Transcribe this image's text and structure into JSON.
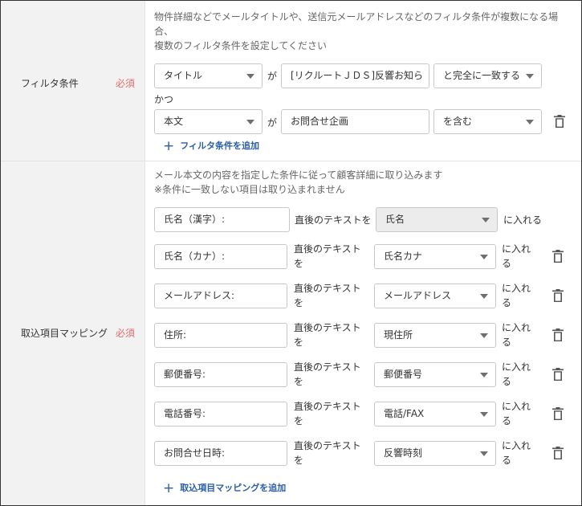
{
  "filter": {
    "label": "フィルタ条件",
    "required": "必須",
    "desc": [
      "物件詳細などでメールタイトルや、送信元メールアドレスなどのフィルタ条件が複数になる場",
      "合、",
      "複数のフィルタ条件を設定してください"
    ],
    "conditions": [
      {
        "field": "タイトル",
        "ga": "が",
        "value": "[リクルートＪＤＳ]反響お知ら",
        "op": "と完全に一致する"
      },
      {
        "field": "本文",
        "ga": "が",
        "value": "お問合せ企画",
        "op": "を含む"
      }
    ],
    "and_text": "かつ",
    "add_label": "フィルタ条件を追加"
  },
  "mapping": {
    "label": "取込項目マッピング",
    "required": "必須",
    "desc": [
      "メール本文の内容を指定した条件に従って顧客詳細に取り込みます",
      "※条件に一致しない項目は取り込まれません"
    ],
    "rows": [
      {
        "key": "氏名（漢字）:",
        "after": "直後のテキストを",
        "target": "氏名",
        "put": "に入れる"
      },
      {
        "key": "氏名（カナ）:",
        "after": [
          "直後のテキスト",
          "を"
        ],
        "target": "氏名カナ",
        "put": [
          "に入れ",
          "る"
        ]
      },
      {
        "key": "メールアドレス:",
        "after": [
          "直後のテキスト",
          "を"
        ],
        "target": "メールアドレス",
        "put": [
          "に入れ",
          "る"
        ]
      },
      {
        "key": "住所:",
        "after": [
          "直後のテキスト",
          "を"
        ],
        "target": "現住所",
        "put": [
          "に入れ",
          "る"
        ]
      },
      {
        "key": "郵便番号:",
        "after": [
          "直後のテキスト",
          "を"
        ],
        "target": "郵便番号",
        "put": [
          "に入れ",
          "る"
        ]
      },
      {
        "key": "電話番号:",
        "after": [
          "直後のテキスト",
          "を"
        ],
        "target": "電話/FAX",
        "put": [
          "に入れ",
          "る"
        ]
      },
      {
        "key": "お問合せ日時:",
        "after": [
          "直後のテキスト",
          "を"
        ],
        "target": "反響時刻",
        "put": [
          "に入れ",
          "る"
        ]
      }
    ],
    "add_label": "取込項目マッピングを追加"
  },
  "icons": {
    "delete": "trash-icon",
    "add": "plus-icon",
    "dropdown": "chevron-down-icon"
  }
}
